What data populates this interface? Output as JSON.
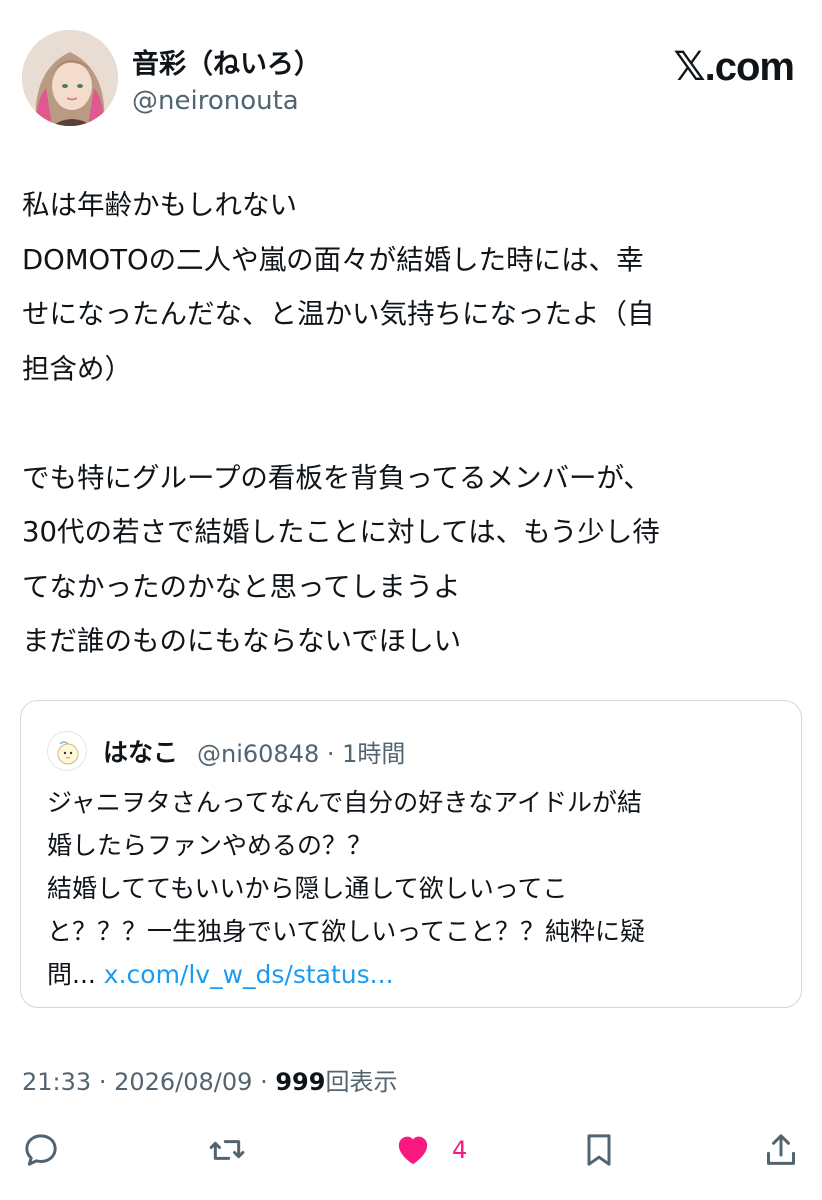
{
  "author": {
    "display_name": "音彩（ねいろ）",
    "handle": "@neironouta"
  },
  "brand": "𝕏.com",
  "tweet": {
    "lines": [
      "私は年齢かもしれない",
      "DOMOTOの二人や嵐の面々が結婚した時には、幸",
      "せになったんだな、と温かい気持ちになったよ（自",
      "担含め）",
      "",
      "でも特にグループの看板を背負ってるメンバーが、",
      "30代の若さで結婚したことに対しては、もう少し待",
      "てなかったのかなと思ってしまうよ",
      "まだ誰のものにもならないでほしい"
    ]
  },
  "quote": {
    "name": "はなこ",
    "handle": "@ni60848",
    "separator": "·",
    "time": "1時間",
    "lines": [
      "ジャニヲタさんってなんで自分の好きなアイドルが結",
      "婚したらファンやめるの？？",
      "結婚しててもいいから隠し通して欲しいってこ",
      "と？？？一生独身でいて欲しいってこと？？純粋に疑"
    ],
    "last_line_prefix": "問...",
    "link": "x.com/lv_w_ds/status..."
  },
  "meta": {
    "time": "21:33",
    "date": "2026/08/09",
    "separator": "·",
    "views_count": "999",
    "views_label": "回表示"
  },
  "actions": {
    "like_count": "4"
  },
  "colors": {
    "text": "#0f1419",
    "secondary": "#536471",
    "link": "#1d9bf0",
    "like": "#f91880",
    "border": "#cfd9de"
  }
}
